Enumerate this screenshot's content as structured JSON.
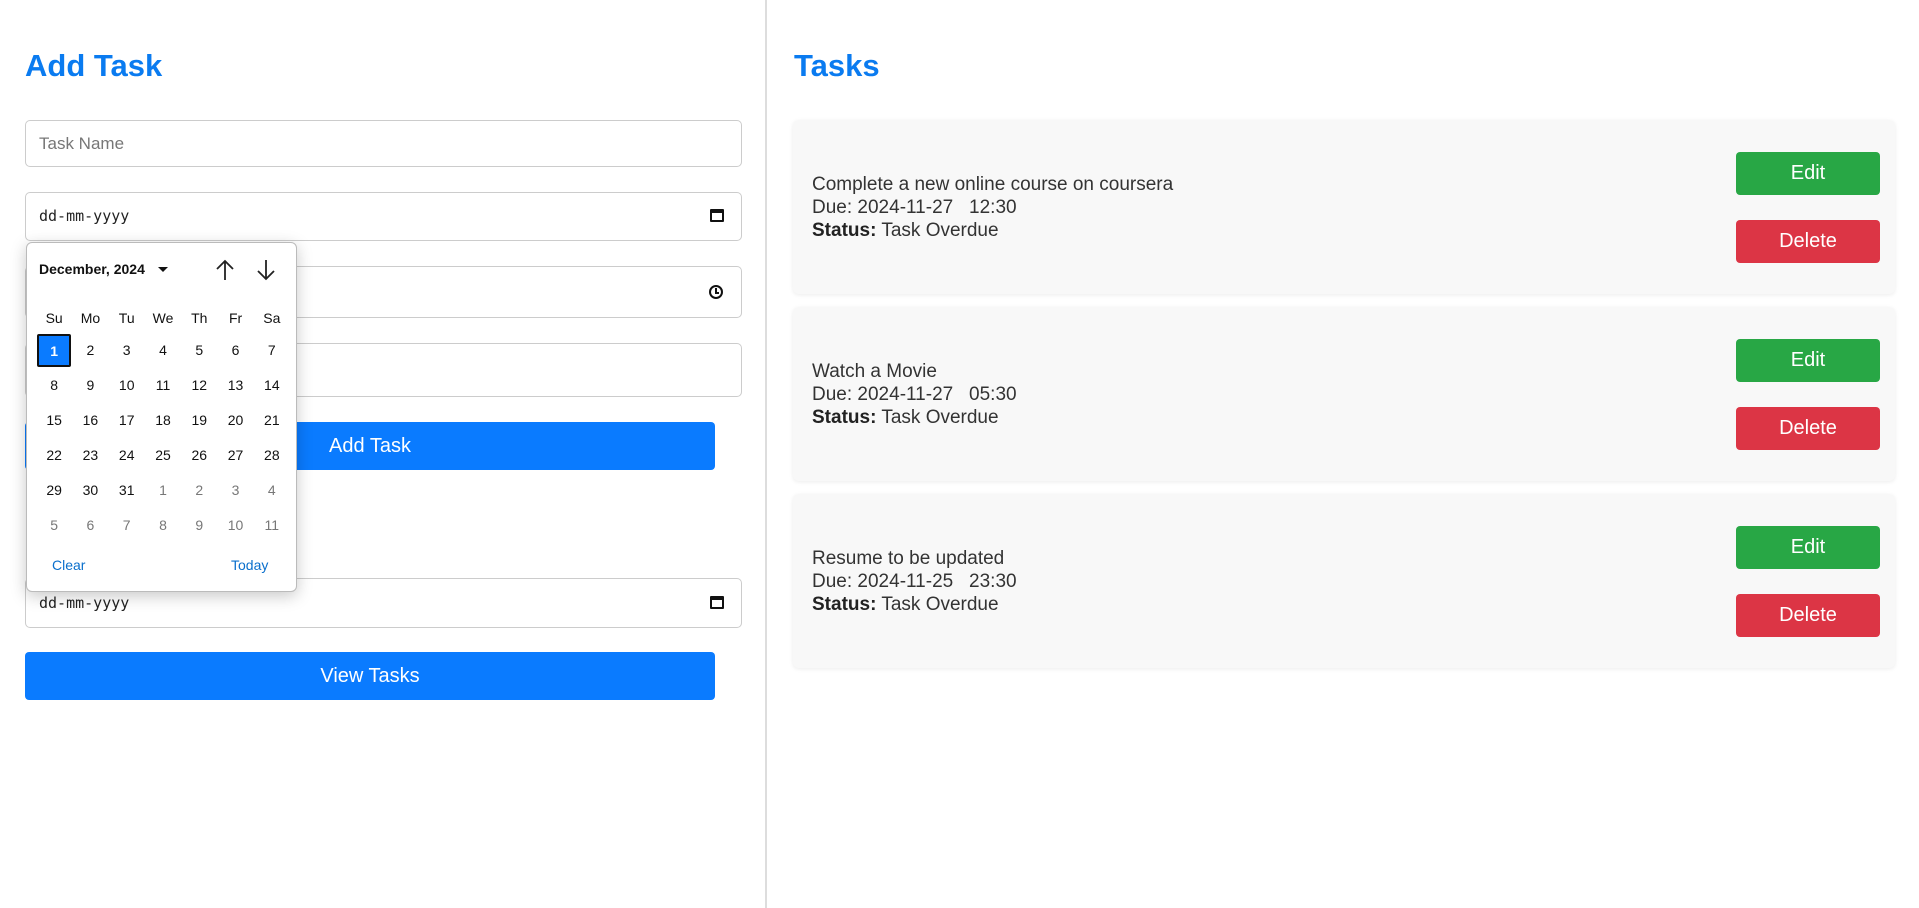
{
  "add_section": {
    "title": "Add Task",
    "task_name_placeholder": "Task Name",
    "date_placeholder": "dd-mm-yyyy",
    "add_button": "Add Task"
  },
  "view_section": {
    "date_placeholder": "dd-mm-yyyy",
    "view_button": "View Tasks"
  },
  "datepicker": {
    "month_label": "December, 2024",
    "weekdays": [
      "Su",
      "Mo",
      "Tu",
      "We",
      "Th",
      "Fr",
      "Sa"
    ],
    "weeks": [
      [
        "1",
        "2",
        "3",
        "4",
        "5",
        "6",
        "7"
      ],
      [
        "8",
        "9",
        "10",
        "11",
        "12",
        "13",
        "14"
      ],
      [
        "15",
        "16",
        "17",
        "18",
        "19",
        "20",
        "21"
      ],
      [
        "22",
        "23",
        "24",
        "25",
        "26",
        "27",
        "28"
      ],
      [
        "29",
        "30",
        "31",
        "1",
        "2",
        "3",
        "4"
      ],
      [
        "5",
        "6",
        "7",
        "8",
        "9",
        "10",
        "11"
      ]
    ],
    "selected_day": "1",
    "clear_label": "Clear",
    "today_label": "Today"
  },
  "tasks_section": {
    "title": "Tasks",
    "due_prefix": "Due:",
    "status_label": "Status:",
    "edit_label": "Edit",
    "delete_label": "Delete",
    "tasks": [
      {
        "name": "Complete a new online course on coursera",
        "date": "2024-11-27",
        "time": "12:30",
        "status": "Task Overdue"
      },
      {
        "name": "Watch a Movie",
        "date": "2024-11-27",
        "time": "05:30",
        "status": "Task Overdue"
      },
      {
        "name": "Resume to be updated",
        "date": "2024-11-25",
        "time": "23:30",
        "status": "Task Overdue"
      }
    ]
  },
  "colors": {
    "primary": "#0a7bff",
    "heading": "#0a7bf0",
    "edit": "#28a745",
    "delete": "#dc3545"
  }
}
